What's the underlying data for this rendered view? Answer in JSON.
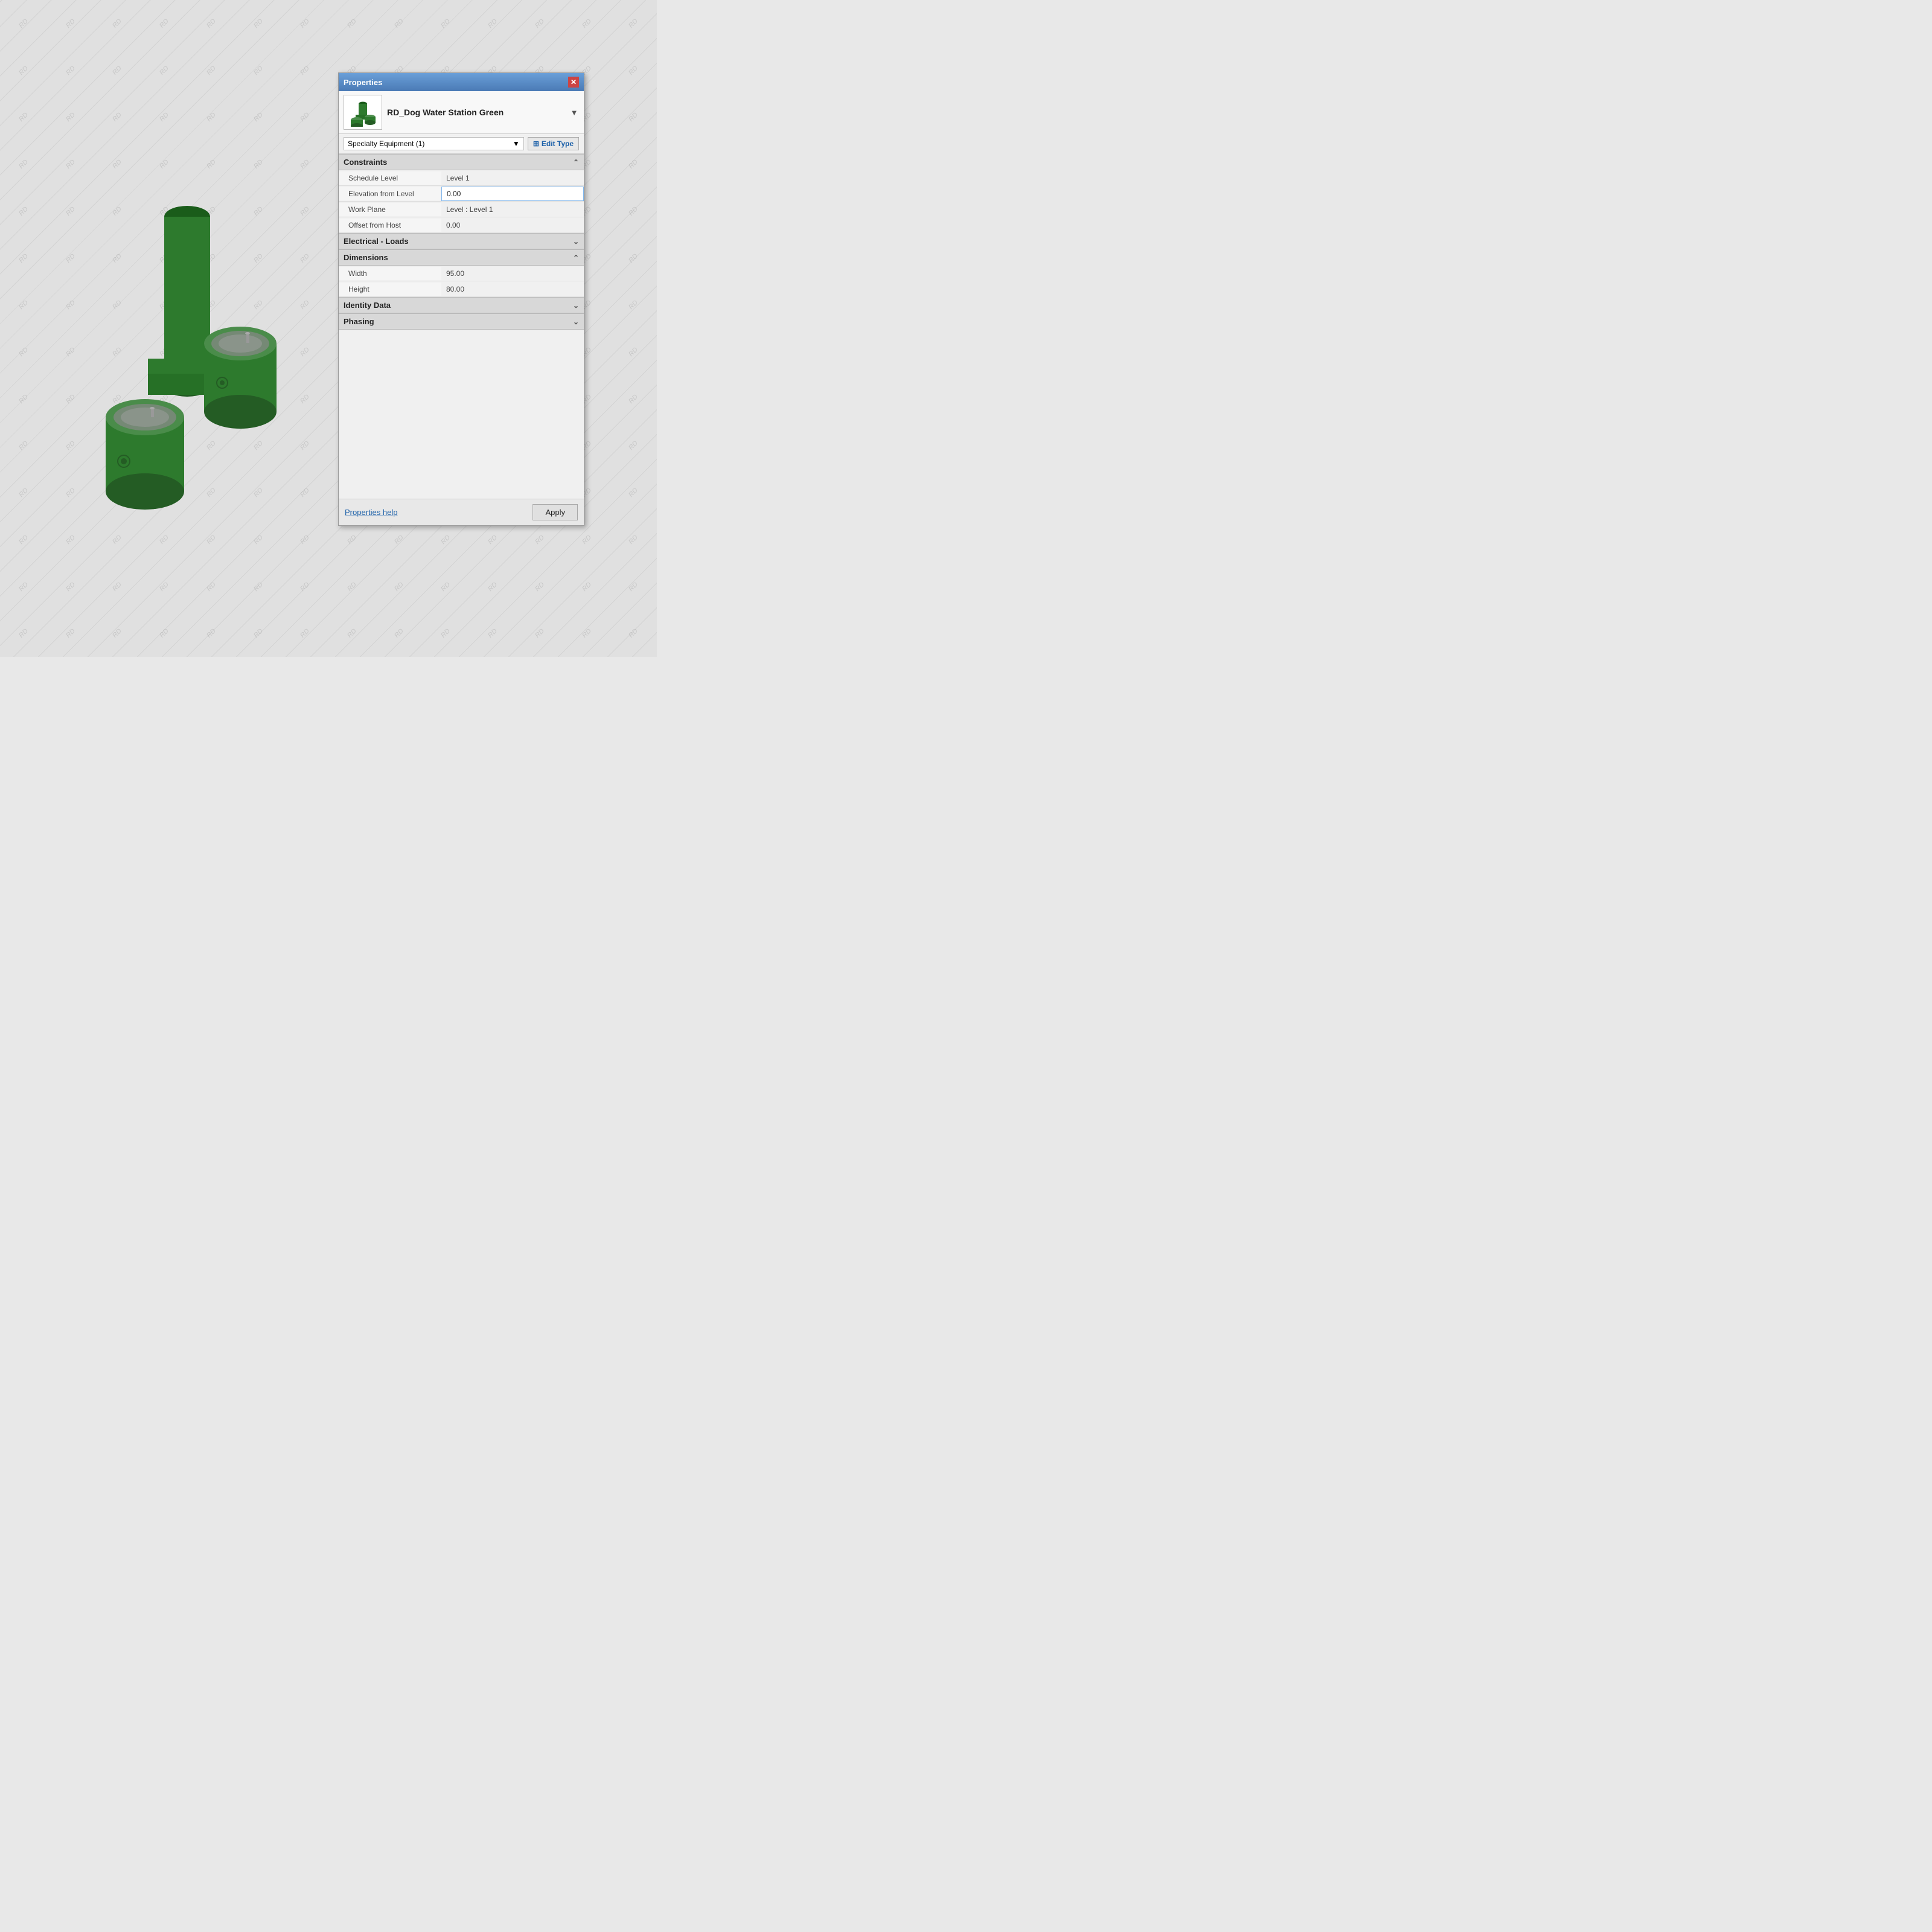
{
  "background": {
    "watermark_text": "RD"
  },
  "panel": {
    "title": "Properties",
    "close_label": "✕",
    "family": {
      "name": "RD_Dog Water Station Green",
      "icon_alt": "dog water station icon"
    },
    "type_selector": {
      "label": "Specialty Equipment (1)",
      "edit_type_label": "Edit Type"
    },
    "sections": {
      "constraints": {
        "label": "Constraints",
        "chevron": "⌃",
        "rows": [
          {
            "label": "Schedule Level",
            "value": "Level 1",
            "editable": false
          },
          {
            "label": "Elevation from Level",
            "value": "0.00",
            "editable": true
          },
          {
            "label": "Work Plane",
            "value": "Level : Level 1",
            "editable": false
          },
          {
            "label": "Offset from Host",
            "value": "0.00",
            "editable": false
          }
        ]
      },
      "electrical_loads": {
        "label": "Electrical - Loads",
        "chevron": "⌄"
      },
      "dimensions": {
        "label": "Dimensions",
        "chevron": "⌃",
        "rows": [
          {
            "label": "Width",
            "value": "95.00",
            "editable": false
          },
          {
            "label": "Height",
            "value": "80.00",
            "editable": false
          }
        ]
      },
      "identity_data": {
        "label": "Identity Data",
        "chevron": "⌄"
      },
      "phasing": {
        "label": "Phasing",
        "chevron": "⌄"
      }
    },
    "footer": {
      "help_link": "Properties help",
      "apply_label": "Apply"
    }
  }
}
